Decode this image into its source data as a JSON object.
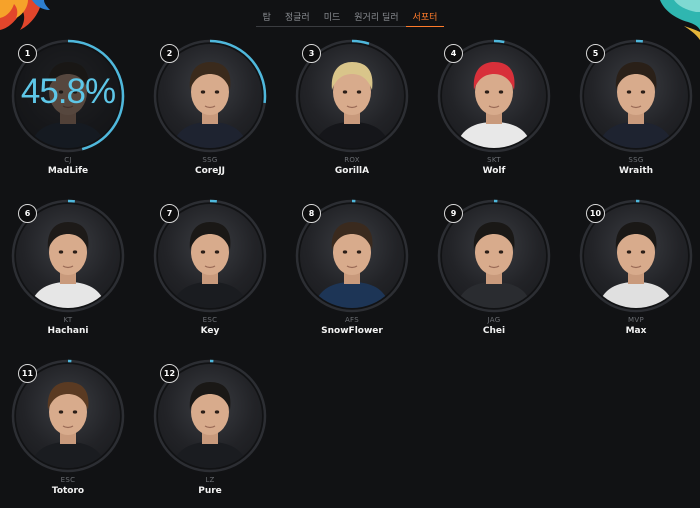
{
  "tabs": [
    {
      "label": "탑",
      "active": false
    },
    {
      "label": "정글러",
      "active": false
    },
    {
      "label": "미드",
      "active": false
    },
    {
      "label": "원거리 딜러",
      "active": false
    },
    {
      "label": "서포터",
      "active": true
    }
  ],
  "colors": {
    "accent": "#ff7b2b",
    "ring": "#4fb8dc",
    "ring_track": "#2c2e33"
  },
  "players": [
    {
      "rank": "1",
      "team": "CJ",
      "name": "MadLife",
      "percent": "45.8%",
      "progress": 0.458,
      "hair": "#2a2118",
      "shirt": "#1e2a3a"
    },
    {
      "rank": "2",
      "team": "SSG",
      "name": "CoreJJ",
      "progress": 0.27,
      "hair": "#3a2a1c",
      "shirt": "#1e2330"
    },
    {
      "rank": "3",
      "team": "ROX",
      "name": "GorillA",
      "progress": 0.05,
      "hair": "#d9c58a",
      "shirt": "#15161a"
    },
    {
      "rank": "4",
      "team": "SKT",
      "name": "Wolf",
      "progress": 0.03,
      "hair": "#d8303a",
      "shirt": "#e8e8e8"
    },
    {
      "rank": "5",
      "team": "SSG",
      "name": "Wraith",
      "progress": 0.02,
      "hair": "#2a2018",
      "shirt": "#1e2330"
    },
    {
      "rank": "6",
      "team": "KT",
      "name": "Hachani",
      "progress": 0.02,
      "hair": "#1d1a18",
      "shirt": "#e6e6e6"
    },
    {
      "rank": "7",
      "team": "ESC",
      "name": "Key",
      "progress": 0.02,
      "hair": "#1a1816",
      "shirt": "#1a1c20"
    },
    {
      "rank": "8",
      "team": "AFS",
      "name": "SnowFlower",
      "progress": 0.01,
      "hair": "#3a2a1e",
      "shirt": "#1d3556"
    },
    {
      "rank": "9",
      "team": "JAG",
      "name": "Chei",
      "progress": 0.01,
      "hair": "#1a1816",
      "shirt": "#2a2c30"
    },
    {
      "rank": "10",
      "team": "MVP",
      "name": "Max",
      "progress": 0.01,
      "hair": "#1a1816",
      "shirt": "#e0e0e0"
    },
    {
      "rank": "11",
      "team": "ESC",
      "name": "Totoro",
      "progress": 0.01,
      "hair": "#5a3a22",
      "shirt": "#1a1c20"
    },
    {
      "rank": "12",
      "team": "LZ",
      "name": "Pure",
      "progress": 0.01,
      "hair": "#1a1816",
      "shirt": "#1a1c20"
    }
  ]
}
